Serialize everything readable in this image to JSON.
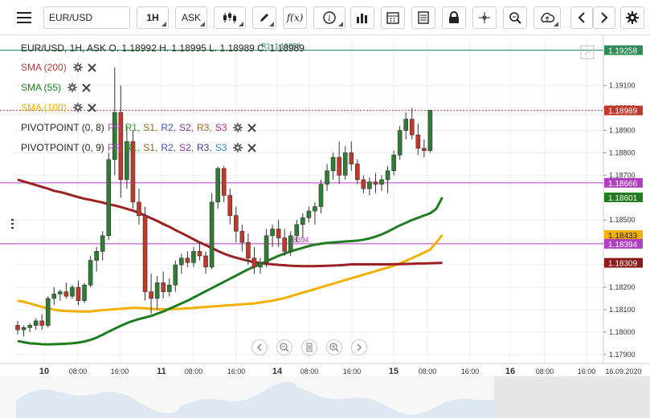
{
  "toolbar": {
    "symbol": "EUR/USD",
    "interval": "1H",
    "price_type": "ASK",
    "fx_label": "f(x)",
    "icons": [
      "menu-icon",
      "candles-icon",
      "pencil-icon",
      "function-icon",
      "info-icon",
      "bar-chart-icon",
      "calendar-icon",
      "document-icon",
      "lock-icon",
      "crosshair-icon",
      "zoom-icon",
      "cloud-upload-icon",
      "arrow-left-icon",
      "arrow-right-icon",
      "gear-icon"
    ]
  },
  "header": {
    "ohlc_text": "EUR/USD, 1H, ASK   O. 1.18992 H. 1.18995 L. 1.18989 C. 1.18989"
  },
  "indicators": [
    {
      "label": "SMA (200)",
      "color": "#b23a3a"
    },
    {
      "label": "SMA (55)",
      "color": "#1f7d1f"
    },
    {
      "label": "SMA (100)",
      "color": "#f4b000"
    }
  ],
  "pivot_rows": [
    {
      "label": "PIVOTPOINT (0, 8)",
      "items": [
        {
          "text": "PP,",
          "color": "#b040c0"
        },
        {
          "text": "R1,",
          "color": "#2a9d2a"
        },
        {
          "text": "S1,",
          "color": "#8a6a1a"
        },
        {
          "text": "R2,",
          "color": "#3a55c0"
        },
        {
          "text": "S2,",
          "color": "#7a3aa0"
        },
        {
          "text": "R3,",
          "color": "#a0622a"
        },
        {
          "text": "S3",
          "color": "#b02a8a"
        }
      ]
    },
    {
      "label": "PIVOTPOINT (0, 9)",
      "items": [
        {
          "text": "PP,",
          "color": "#b040c0"
        },
        {
          "text": "R1,",
          "color": "#2a9d2a"
        },
        {
          "text": "S1,",
          "color": "#8a6a1a"
        },
        {
          "text": "R2,",
          "color": "#3a55c0"
        },
        {
          "text": "S2,",
          "color": "#7a3aa0"
        },
        {
          "text": "R3,",
          "color": "#3a3aa0"
        },
        {
          "text": "S3",
          "color": "#2a8ab0"
        }
      ]
    }
  ],
  "chart_data": {
    "type": "candlestick",
    "symbol": "EUR/USD",
    "interval": "1H",
    "y_range": [
      1.1786,
      1.1931
    ],
    "y_ticks": [
      "1.19100",
      "1.19000",
      "1.18900",
      "1.18800",
      "1.18700",
      "1.18500",
      "1.18400",
      "1.18300",
      "1.18200",
      "1.18100",
      "1.18000",
      "1.17900"
    ],
    "x_ticks": [
      {
        "label": "10",
        "major": true
      },
      {
        "label": "08:00"
      },
      {
        "label": "16:00"
      },
      {
        "label": "11",
        "major": true
      },
      {
        "label": "08:00"
      },
      {
        "label": "16:00"
      },
      {
        "label": "14",
        "major": true
      },
      {
        "label": "08:00"
      },
      {
        "label": "16:00"
      },
      {
        "label": "15",
        "major": true
      },
      {
        "label": "08:00"
      },
      {
        "label": "16:00"
      },
      {
        "label": "16",
        "major": true
      },
      {
        "label": "08:00"
      },
      {
        "label": "16:00"
      },
      {
        "label": "16.09.2020"
      }
    ],
    "price_tags": [
      {
        "value": 1.19258,
        "label": "1.19258",
        "bg": "#2e8b57",
        "fg": "#ffffff"
      },
      {
        "value": 1.18989,
        "label": "1.18989",
        "bg": "#c0392b",
        "fg": "#ffffff"
      },
      {
        "value": 1.18666,
        "label": "1.18666",
        "bg": "#b040c0",
        "fg": "#ffffff"
      },
      {
        "value": 1.18601,
        "label": "1.18601",
        "bg": "#1f7d1f",
        "fg": "#ffffff"
      },
      {
        "value": 1.18433,
        "label": "1.18433",
        "bg": "#f4b000",
        "fg": "#222222"
      },
      {
        "value": 1.18394,
        "label": "1.18394",
        "bg": "#b040c0",
        "fg": "#ffffff"
      },
      {
        "value": 1.18309,
        "label": "1.18309",
        "bg": "#8b1a1a",
        "fg": "#ffffff"
      }
    ],
    "pivot_lines": [
      {
        "value": 1.19258,
        "label": "R1: 1.19258",
        "color": "#2e8b57"
      },
      {
        "value": 1.18666,
        "label": "",
        "color": "#b040c0"
      },
      {
        "value": 1.18394,
        "label": "1.18394",
        "color": "#b040c0"
      }
    ],
    "last_price": 1.18989,
    "candles": [
      {
        "o": 1.1803,
        "h": 1.1805,
        "l": 1.1799,
        "c": 1.1801
      },
      {
        "o": 1.1801,
        "h": 1.1803,
        "l": 1.1798,
        "c": 1.1802
      },
      {
        "o": 1.1802,
        "h": 1.1804,
        "l": 1.18,
        "c": 1.1803
      },
      {
        "o": 1.1803,
        "h": 1.1806,
        "l": 1.1801,
        "c": 1.1805
      },
      {
        "o": 1.1805,
        "h": 1.1808,
        "l": 1.1801,
        "c": 1.1803
      },
      {
        "o": 1.1803,
        "h": 1.1816,
        "l": 1.1802,
        "c": 1.1815
      },
      {
        "o": 1.1815,
        "h": 1.182,
        "l": 1.1812,
        "c": 1.1817
      },
      {
        "o": 1.1817,
        "h": 1.1819,
        "l": 1.1814,
        "c": 1.1818
      },
      {
        "o": 1.1818,
        "h": 1.1822,
        "l": 1.1815,
        "c": 1.1816
      },
      {
        "o": 1.1816,
        "h": 1.1821,
        "l": 1.1815,
        "c": 1.182
      },
      {
        "o": 1.182,
        "h": 1.1823,
        "l": 1.1812,
        "c": 1.1814
      },
      {
        "o": 1.1814,
        "h": 1.1822,
        "l": 1.1813,
        "c": 1.1821
      },
      {
        "o": 1.1821,
        "h": 1.1834,
        "l": 1.182,
        "c": 1.1832
      },
      {
        "o": 1.1832,
        "h": 1.1838,
        "l": 1.1827,
        "c": 1.1836
      },
      {
        "o": 1.1836,
        "h": 1.1845,
        "l": 1.1832,
        "c": 1.1843
      },
      {
        "o": 1.1843,
        "h": 1.188,
        "l": 1.1841,
        "c": 1.1877
      },
      {
        "o": 1.1877,
        "h": 1.1918,
        "l": 1.187,
        "c": 1.1898
      },
      {
        "o": 1.1898,
        "h": 1.191,
        "l": 1.186,
        "c": 1.1868
      },
      {
        "o": 1.1868,
        "h": 1.1892,
        "l": 1.1864,
        "c": 1.1885
      },
      {
        "o": 1.1885,
        "h": 1.189,
        "l": 1.1855,
        "c": 1.1858
      },
      {
        "o": 1.1858,
        "h": 1.1864,
        "l": 1.1848,
        "c": 1.1852
      },
      {
        "o": 1.1852,
        "h": 1.1856,
        "l": 1.1814,
        "c": 1.1818
      },
      {
        "o": 1.1818,
        "h": 1.1826,
        "l": 1.1808,
        "c": 1.1815
      },
      {
        "o": 1.1815,
        "h": 1.1825,
        "l": 1.181,
        "c": 1.1822
      },
      {
        "o": 1.1822,
        "h": 1.1827,
        "l": 1.1815,
        "c": 1.1818
      },
      {
        "o": 1.1818,
        "h": 1.1824,
        "l": 1.1816,
        "c": 1.1821
      },
      {
        "o": 1.1821,
        "h": 1.1832,
        "l": 1.1818,
        "c": 1.183
      },
      {
        "o": 1.183,
        "h": 1.1835,
        "l": 1.1826,
        "c": 1.1833
      },
      {
        "o": 1.1833,
        "h": 1.1836,
        "l": 1.1829,
        "c": 1.1831
      },
      {
        "o": 1.1831,
        "h": 1.1838,
        "l": 1.1829,
        "c": 1.1836
      },
      {
        "o": 1.1836,
        "h": 1.184,
        "l": 1.1832,
        "c": 1.1834
      },
      {
        "o": 1.1834,
        "h": 1.1836,
        "l": 1.1826,
        "c": 1.1829
      },
      {
        "o": 1.1829,
        "h": 1.1862,
        "l": 1.1828,
        "c": 1.1858
      },
      {
        "o": 1.1858,
        "h": 1.1874,
        "l": 1.1855,
        "c": 1.1873
      },
      {
        "o": 1.1873,
        "h": 1.1874,
        "l": 1.1858,
        "c": 1.1861
      },
      {
        "o": 1.1861,
        "h": 1.1864,
        "l": 1.1848,
        "c": 1.1852
      },
      {
        "o": 1.1852,
        "h": 1.1856,
        "l": 1.184,
        "c": 1.1845
      },
      {
        "o": 1.1845,
        "h": 1.1848,
        "l": 1.1836,
        "c": 1.184
      },
      {
        "o": 1.184,
        "h": 1.1844,
        "l": 1.183,
        "c": 1.1833
      },
      {
        "o": 1.1833,
        "h": 1.1838,
        "l": 1.1826,
        "c": 1.1829
      },
      {
        "o": 1.1829,
        "h": 1.1833,
        "l": 1.1826,
        "c": 1.1831
      },
      {
        "o": 1.1831,
        "h": 1.1846,
        "l": 1.1829,
        "c": 1.1843
      },
      {
        "o": 1.1843,
        "h": 1.1848,
        "l": 1.1838,
        "c": 1.1846
      },
      {
        "o": 1.1846,
        "h": 1.185,
        "l": 1.1838,
        "c": 1.1842
      },
      {
        "o": 1.1842,
        "h": 1.1846,
        "l": 1.1834,
        "c": 1.1836
      },
      {
        "o": 1.1836,
        "h": 1.1845,
        "l": 1.1834,
        "c": 1.1843
      },
      {
        "o": 1.1843,
        "h": 1.185,
        "l": 1.184,
        "c": 1.1848
      },
      {
        "o": 1.1848,
        "h": 1.1853,
        "l": 1.1842,
        "c": 1.1851
      },
      {
        "o": 1.1851,
        "h": 1.1856,
        "l": 1.1849,
        "c": 1.1854
      },
      {
        "o": 1.1854,
        "h": 1.1858,
        "l": 1.1848,
        "c": 1.1856
      },
      {
        "o": 1.1856,
        "h": 1.1868,
        "l": 1.1853,
        "c": 1.1866
      },
      {
        "o": 1.1866,
        "h": 1.1875,
        "l": 1.1863,
        "c": 1.1872
      },
      {
        "o": 1.1872,
        "h": 1.188,
        "l": 1.1868,
        "c": 1.1878
      },
      {
        "o": 1.1878,
        "h": 1.1885,
        "l": 1.1866,
        "c": 1.187
      },
      {
        "o": 1.187,
        "h": 1.1883,
        "l": 1.1868,
        "c": 1.188
      },
      {
        "o": 1.188,
        "h": 1.1885,
        "l": 1.1872,
        "c": 1.1875
      },
      {
        "o": 1.1875,
        "h": 1.1877,
        "l": 1.1866,
        "c": 1.1868
      },
      {
        "o": 1.1868,
        "h": 1.187,
        "l": 1.1862,
        "c": 1.1864
      },
      {
        "o": 1.1864,
        "h": 1.1869,
        "l": 1.1861,
        "c": 1.1867
      },
      {
        "o": 1.1867,
        "h": 1.1871,
        "l": 1.1862,
        "c": 1.1866
      },
      {
        "o": 1.1866,
        "h": 1.187,
        "l": 1.1863,
        "c": 1.1868
      },
      {
        "o": 1.1868,
        "h": 1.1874,
        "l": 1.1862,
        "c": 1.1872
      },
      {
        "o": 1.1872,
        "h": 1.1881,
        "l": 1.187,
        "c": 1.1879
      },
      {
        "o": 1.1879,
        "h": 1.1892,
        "l": 1.1877,
        "c": 1.189
      },
      {
        "o": 1.189,
        "h": 1.1898,
        "l": 1.1886,
        "c": 1.1895
      },
      {
        "o": 1.1895,
        "h": 1.19,
        "l": 1.1886,
        "c": 1.1888
      },
      {
        "o": 1.1888,
        "h": 1.1893,
        "l": 1.1879,
        "c": 1.1882
      },
      {
        "o": 1.1882,
        "h": 1.1886,
        "l": 1.1878,
        "c": 1.1881
      },
      {
        "o": 1.1881,
        "h": 1.1899,
        "l": 1.188,
        "c": 1.1899
      }
    ],
    "sma_200": [
      1.1868,
      1.18672,
      1.18664,
      1.18656,
      1.18648,
      1.1864,
      1.1863,
      1.18625,
      1.18618,
      1.1861,
      1.18602,
      1.18595,
      1.1859,
      1.18584,
      1.18578,
      1.1857,
      1.18565,
      1.18558,
      1.1855,
      1.18542,
      1.18532,
      1.1852,
      1.18508,
      1.18496,
      1.18482,
      1.1847,
      1.18455,
      1.18442,
      1.18428,
      1.18414,
      1.184,
      1.18388,
      1.18375,
      1.18362,
      1.1835,
      1.1834,
      1.18332,
      1.18325,
      1.18318,
      1.18312,
      1.18308,
      1.18305,
      1.18302,
      1.183,
      1.18298,
      1.18296,
      1.18295,
      1.18294,
      1.18294,
      1.18294,
      1.18295,
      1.18296,
      1.18297,
      1.18298,
      1.183,
      1.18302,
      1.18302,
      1.18302,
      1.18302,
      1.18302,
      1.18302,
      1.18302,
      1.18303,
      1.18303,
      1.18304,
      1.18305,
      1.18306,
      1.18306,
      1.18307,
      1.18308,
      1.18309
    ],
    "sma_55": [
      1.1796,
      1.17955,
      1.1795,
      1.17948,
      1.17946,
      1.17945,
      1.17946,
      1.17947,
      1.17948,
      1.1795,
      1.17953,
      1.17958,
      1.17965,
      1.17975,
      1.17988,
      1.18002,
      1.18015,
      1.18028,
      1.1804,
      1.1805,
      1.18058,
      1.18065,
      1.18072,
      1.18082,
      1.18092,
      1.18104,
      1.18116,
      1.18128,
      1.1814,
      1.18154,
      1.18168,
      1.18182,
      1.18196,
      1.1821,
      1.18224,
      1.18238,
      1.18252,
      1.18266,
      1.1828,
      1.18292,
      1.18304,
      1.18316,
      1.18328,
      1.1834,
      1.1835,
      1.1836,
      1.18368,
      1.18376,
      1.18384,
      1.1839,
      1.18394,
      1.18398,
      1.184,
      1.18402,
      1.18404,
      1.18406,
      1.18408,
      1.18412,
      1.18418,
      1.18426,
      1.18436,
      1.18448,
      1.18462,
      1.18476,
      1.18488,
      1.185,
      1.1851,
      1.1852,
      1.1853,
      1.1855,
      1.18601
    ],
    "sma_100": [
      1.1814,
      1.18135,
      1.18128,
      1.1812,
      1.18112,
      1.18106,
      1.181,
      1.18096,
      1.18094,
      1.18093,
      1.18092,
      1.18092,
      1.18092,
      1.18095,
      1.18098,
      1.181,
      1.18102,
      1.18104,
      1.18106,
      1.18108,
      1.18108,
      1.18106,
      1.18104,
      1.18102,
      1.18102,
      1.18102,
      1.18103,
      1.18104,
      1.18106,
      1.18108,
      1.1811,
      1.18112,
      1.18114,
      1.18116,
      1.18118,
      1.1812,
      1.18122,
      1.18124,
      1.18126,
      1.18128,
      1.18132,
      1.18136,
      1.1814,
      1.18146,
      1.18152,
      1.1816,
      1.18168,
      1.18176,
      1.18184,
      1.18192,
      1.182,
      1.18208,
      1.18216,
      1.18224,
      1.18232,
      1.1824,
      1.18248,
      1.18256,
      1.18264,
      1.18272,
      1.1828,
      1.18288,
      1.18296,
      1.18306,
      1.18318,
      1.1833,
      1.18342,
      1.18355,
      1.18368,
      1.184,
      1.18433
    ]
  }
}
